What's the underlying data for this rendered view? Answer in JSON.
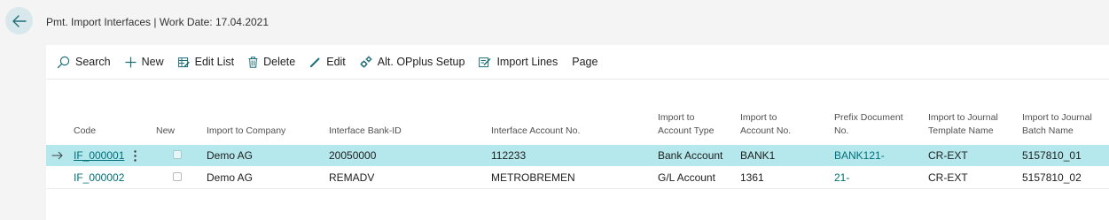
{
  "header": {
    "title": "Pmt. Import Interfaces | Work Date: 17.04.2021"
  },
  "toolbar": {
    "search_label": "Search",
    "new_label": "New",
    "edit_list_label": "Edit List",
    "delete_label": "Delete",
    "edit_label": "Edit",
    "alt_setup_label": "Alt. OPplus Setup",
    "import_lines_label": "Import Lines",
    "page_label": "Page"
  },
  "table": {
    "headers": {
      "code": "Code",
      "new": "New",
      "import_to_company": "Import to Company",
      "interface_bank_id": "Interface Bank-ID",
      "interface_account_no": "Interface Account No.",
      "import_to_account_type_1": "Import to",
      "import_to_account_type_2": "Account Type",
      "import_to_account_no_1": "Import to",
      "import_to_account_no_2": "Account No.",
      "prefix_document_no_1": "Prefix Document",
      "prefix_document_no_2": "No.",
      "journal_template_1": "Import to Journal",
      "journal_template_2": "Template Name",
      "journal_batch_1": "Import to Journal",
      "journal_batch_2": "Batch Name"
    },
    "rows": [
      {
        "code": "IF_000001",
        "new": false,
        "import_to_company": "Demo AG",
        "interface_bank_id": "20050000",
        "interface_account_no": "112233",
        "account_type": "Bank Account",
        "account_no": "BANK1",
        "prefix_document_no": "BANK121-",
        "journal_template": "CR-EXT",
        "journal_batch": "5157810_01"
      },
      {
        "code": "IF_000002",
        "new": false,
        "import_to_company": "Demo AG",
        "interface_bank_id": "REMADV",
        "interface_account_no": "METROBREMEN",
        "account_type": "G/L Account",
        "account_no": "1361",
        "prefix_document_no": "21-",
        "journal_template": "CR-EXT",
        "journal_batch": "5157810_02"
      }
    ]
  },
  "colors": {
    "accent": "#00707a",
    "selected_row": "#b5e8ec",
    "back_button": "#d9e8ec"
  }
}
